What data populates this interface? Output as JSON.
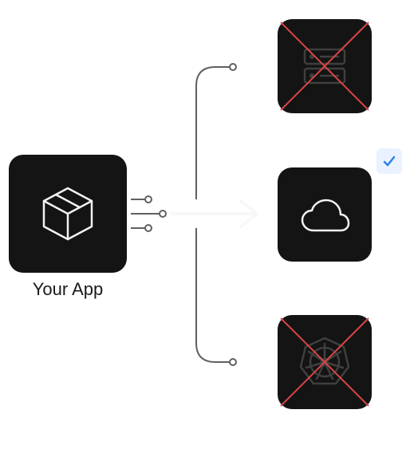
{
  "app": {
    "label": "Your App",
    "icon_name": "package-icon"
  },
  "destinations": {
    "server": {
      "icon_name": "server-icon",
      "crossed_out": true,
      "selected": false
    },
    "cloud": {
      "icon_name": "cloud-icon",
      "crossed_out": false,
      "selected": true
    },
    "k8s": {
      "icon_name": "kubernetes-icon",
      "crossed_out": true,
      "selected": false
    }
  },
  "colors": {
    "card_bg": "#141414",
    "icon_light": "#f2f2f2",
    "icon_dim": "#3f3f3f",
    "connector": "#606060",
    "arrow": "#f8f8f8",
    "cross": "#d94646",
    "check_bg": "#eaf2ff",
    "check_fg": "#2e7fe6"
  }
}
